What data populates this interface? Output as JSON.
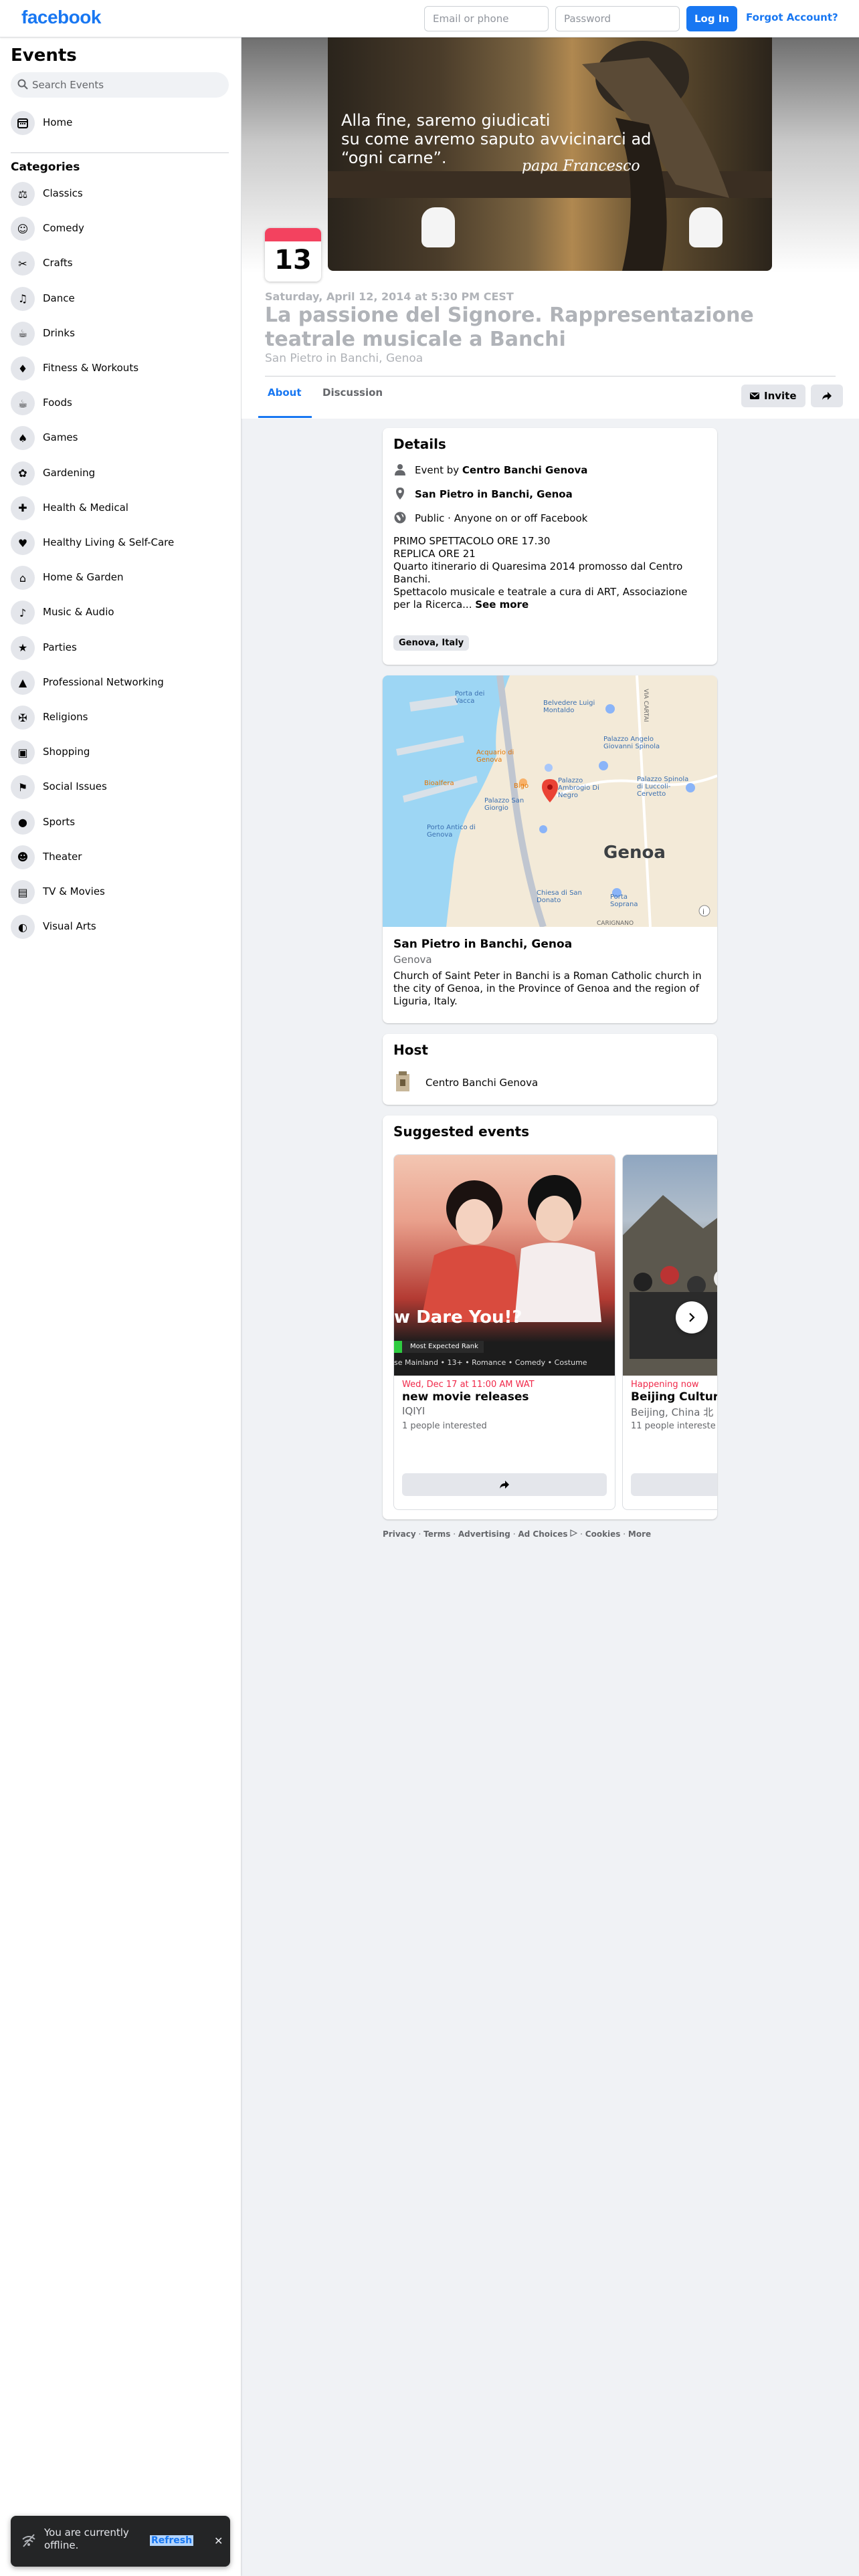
{
  "header": {
    "logo": "facebook",
    "email_placeholder": "Email or phone",
    "password_placeholder": "Password",
    "login_label": "Log In",
    "forgot_label": "Forgot Account?"
  },
  "sidebar": {
    "title": "Events",
    "search_placeholder": "Search Events",
    "home_label": "Home",
    "categories_title": "Categories",
    "categories": [
      {
        "label": "Classics",
        "icon": "classics-icon"
      },
      {
        "label": "Comedy",
        "icon": "comedy-icon"
      },
      {
        "label": "Crafts",
        "icon": "crafts-icon"
      },
      {
        "label": "Dance",
        "icon": "dance-icon"
      },
      {
        "label": "Drinks",
        "icon": "drinks-icon"
      },
      {
        "label": "Fitness & Workouts",
        "icon": "fitness-icon"
      },
      {
        "label": "Foods",
        "icon": "foods-icon"
      },
      {
        "label": "Games",
        "icon": "games-icon"
      },
      {
        "label": "Gardening",
        "icon": "gardening-icon"
      },
      {
        "label": "Health & Medical",
        "icon": "health-icon"
      },
      {
        "label": "Healthy Living & Self-Care",
        "icon": "self-care-icon"
      },
      {
        "label": "Home & Garden",
        "icon": "home-garden-icon"
      },
      {
        "label": "Music & Audio",
        "icon": "music-icon"
      },
      {
        "label": "Parties",
        "icon": "parties-icon"
      },
      {
        "label": "Professional Networking",
        "icon": "networking-icon"
      },
      {
        "label": "Religions",
        "icon": "religions-icon"
      },
      {
        "label": "Shopping",
        "icon": "shopping-icon"
      },
      {
        "label": "Social Issues",
        "icon": "social-issues-icon"
      },
      {
        "label": "Sports",
        "icon": "sports-icon"
      },
      {
        "label": "Theater",
        "icon": "theater-icon"
      },
      {
        "label": "TV & Movies",
        "icon": "tv-movies-icon"
      },
      {
        "label": "Visual Arts",
        "icon": "visual-arts-icon"
      }
    ]
  },
  "event": {
    "cover_quote_lines": [
      "Alla fine, saremo giudicati",
      "su come avremo saputo avvicinarci ad",
      "“ogni carne”."
    ],
    "cover_signature": "papa Francesco",
    "day": "13",
    "date": "Saturday, April 12, 2014 at 5:30 PM CEST",
    "title": "La passione del Signore. Rappresentazione teatrale musicale a Banchi",
    "location": "San Pietro in Banchi, Genoa",
    "tabs": {
      "about": "About",
      "discussion": "Discussion"
    },
    "invite_label": "Invite"
  },
  "details": {
    "title": "Details",
    "event_by_prefix": "Event by",
    "organizer": "Centro Banchi Genova",
    "venue": "San Pietro in Banchi, Genoa",
    "privacy": "Public · Anyone on or off Facebook",
    "desc_lines": [
      "PRIMO SPETTACOLO ORE 17.30",
      "REPLICA ORE 21",
      "Quarto itinerario di Quaresima 2014 promosso dal Centro Banchi.",
      "Spettacolo musicale e teatrale a cura di ART, Associazione per la Ricerca..."
    ],
    "see_more": "See more",
    "tag": "Genova, Italy"
  },
  "map": {
    "labels": [
      "Porta dei Vacca",
      "Belvedere Luigi Montaldo",
      "Acquario di Genova",
      "Palazzo Angelo Giovanni Spinola",
      "Bigo",
      "Palazzo Ambrogio Di Negro",
      "Palazzo Spinola di Luccoli-Cervetto",
      "Palazzo San Giorgio",
      "Porto Antico di Genova",
      "Genoa",
      "Chiesa di San Donato",
      "Porta Soprana",
      "VIA CARTAI",
      "CARIGNANO",
      "Bioalfera"
    ],
    "place_name": "San Pietro in Banchi, Genoa",
    "place_city": "Genova",
    "place_desc": "Church of Saint Peter in Banchi is a Roman Catholic church in the city of Genoa, in the Province of Genoa and the region of Liguria, Italy."
  },
  "host": {
    "title": "Host",
    "name": "Centro Banchi Genova"
  },
  "suggested": {
    "title": "Suggested events",
    "items": [
      {
        "banner": "w Dare You!?",
        "badge": "Most Expected Rank",
        "meta": "se Mainland • 13+ • Romance • Comedy • Costume",
        "date": "Wed, Dec 17 at 11:00 AM WAT",
        "title": "new movie releases",
        "sub": "IQIYI",
        "interested": "1 people interested"
      },
      {
        "date": "Happening now",
        "title": "Beijing Cultur",
        "sub": "Beijing, China 北",
        "interested": "11 people intereste"
      }
    ]
  },
  "footer": {
    "links": [
      "Privacy",
      "Terms",
      "Advertising",
      "Ad Choices",
      "Cookies",
      "More"
    ]
  },
  "toast": {
    "message": "You are currently offline.",
    "action": "Refresh"
  }
}
